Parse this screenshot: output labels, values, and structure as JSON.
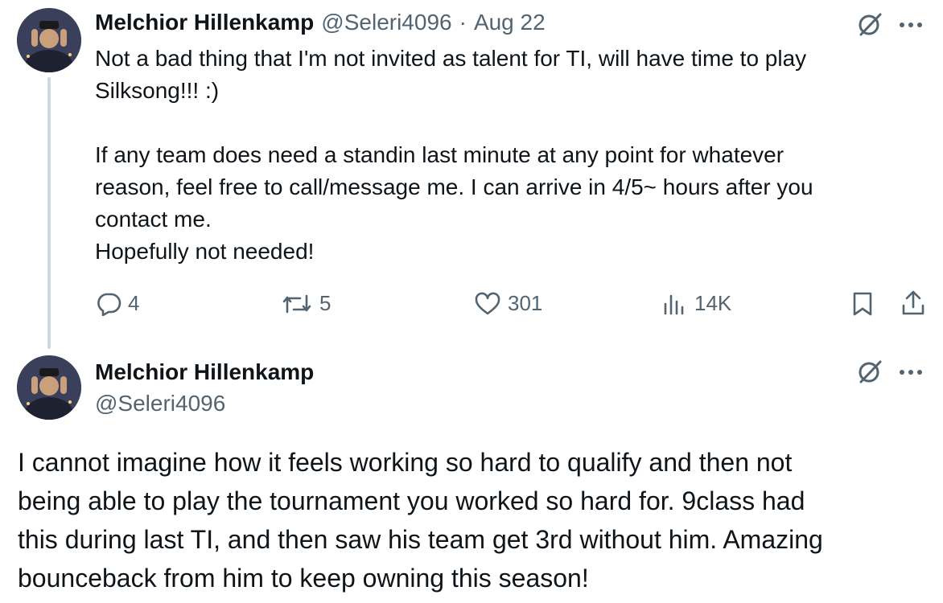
{
  "tweet1": {
    "author_name": "Melchior Hillenkamp",
    "handle": "@Seleri4096",
    "separator": "·",
    "date": "Aug 22",
    "text_lines": [
      "Not a bad thing that I'm not invited as talent for TI, will have time to play",
      "Silksong!!! :)",
      "",
      "If any team does need a standin last minute at any point for whatever",
      "reason, feel free to call/message me. I can arrive in 4/5~ hours after you",
      "contact me.",
      "Hopefully not needed!"
    ],
    "actions": {
      "replies": "4",
      "reposts": "5",
      "likes": "301",
      "views": "14K"
    }
  },
  "tweet2": {
    "author_name": "Melchior Hillenkamp",
    "handle": "@Seleri4096",
    "text_lines": [
      "I cannot imagine how it feels working so hard to qualify and then not",
      "being able to play the tournament you worked so hard for. 9class had",
      "this during last TI, and then saw his team get 3rd without him. Amazing",
      "bounceback from him to keep owning this season!"
    ]
  },
  "icons": {
    "avatar": "profile-photo",
    "grok": "grok-icon",
    "more": "more-icon",
    "reply": "reply-icon",
    "repost": "repost-icon",
    "like": "heart-icon",
    "views": "views-icon",
    "bookmark": "bookmark-icon",
    "share": "share-icon"
  },
  "colors": {
    "text": "#0f1419",
    "muted": "#536471",
    "thread_line": "#cfd9de"
  }
}
